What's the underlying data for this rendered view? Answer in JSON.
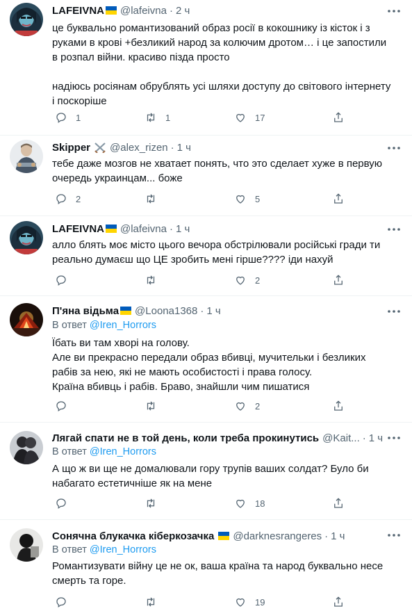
{
  "tweets": [
    {
      "name": "LAFEIVNA",
      "handle": "@lafeivna",
      "sep": "·",
      "time": "2 ч",
      "reply_prefix": "",
      "reply_to": "",
      "paragraphs": [
        "це буквально романтизований образ росії в кокошнику із кісток і з руками в крові +безликий народ за колючим дротом… і це запостили в розпал війни. красиво пізда просто",
        "надіюсь росіянам обрублять усі шляхи доступу до світового інтернету і поскоріше"
      ],
      "replies": "1",
      "retweets": "1",
      "likes": "17"
    },
    {
      "name": "Skipper",
      "handle": "@alex_rizen",
      "sep": "·",
      "time": "1 ч",
      "reply_prefix": "",
      "reply_to": "",
      "paragraphs": [
        "тебе даже мозгов не хватает понять, что это сделает хуже в первую очередь украинцам... боже"
      ],
      "replies": "2",
      "retweets": "",
      "likes": "5"
    },
    {
      "name": "LAFEIVNA",
      "handle": "@lafeivna",
      "sep": "·",
      "time": "1 ч",
      "reply_prefix": "",
      "reply_to": "",
      "paragraphs": [
        "алло блять моє місто цього вечора обстрілювали російські гради ти реально думаєш що ЦЕ зробить мені гірше???? іди нахуй"
      ],
      "replies": "",
      "retweets": "",
      "likes": "2"
    },
    {
      "name": "П'яна відьма",
      "handle": "@Loona1368",
      "sep": "·",
      "time": "1 ч",
      "reply_prefix": "В ответ ",
      "reply_to": "@Iren_Horrors",
      "paragraphs": [
        "Їбать ви там хворі на голову.",
        "Але ви прекрасно передали образ вбивці, мучительки і безликих рабів за нею, які не мають особистості і права голосу.",
        "Країна вбивць і рабів. Браво, знайшли чим пишатися"
      ],
      "replies": "",
      "retweets": "",
      "likes": "2"
    },
    {
      "name": "Лягай спати не в той день, коли треба прокинутись",
      "handle": "@Kait...",
      "sep": "·",
      "time": "1 ч",
      "reply_prefix": "В ответ ",
      "reply_to": "@Iren_Horrors",
      "paragraphs": [
        "А що ж ви ще не домалювали гору трупів ваших солдат? Було би набагато естетичніше як на мене"
      ],
      "replies": "",
      "retweets": "",
      "likes": "18"
    },
    {
      "name": "Сонячна блукачка кіберкозачка",
      "handle": "@darknesrangeres",
      "sep": "·",
      "time": "1 ч",
      "reply_prefix": "В ответ ",
      "reply_to": "@Iren_Horrors",
      "paragraphs": [
        "Романтизувати війну це не ок, ваша країна та народ буквально несе смерть та горе."
      ],
      "replies": "",
      "retweets": "",
      "likes": "19"
    }
  ]
}
